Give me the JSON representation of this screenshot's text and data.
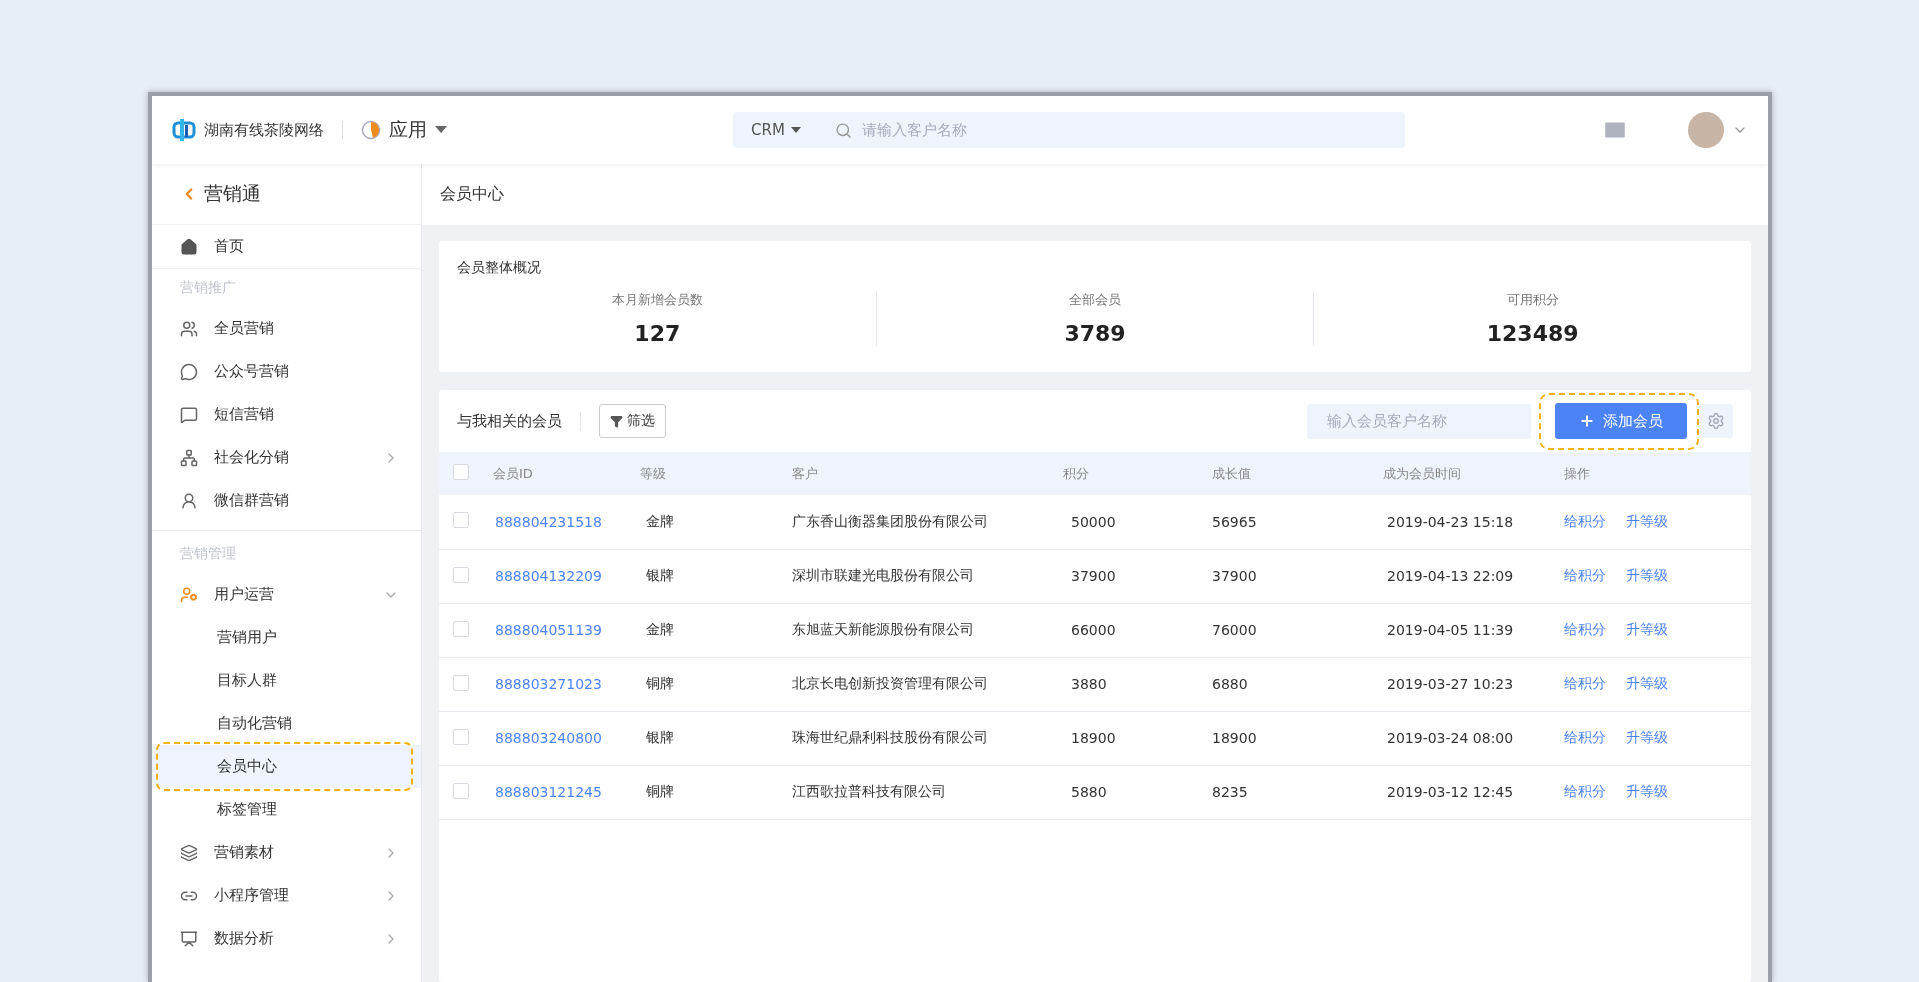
{
  "header": {
    "org_name": "湖南有线茶陵网络",
    "app_switcher": "应用",
    "scope": "CRM",
    "search": {
      "placeholder": "请输入客户名称"
    }
  },
  "sidebar": {
    "title": "营销通",
    "home": {
      "label": "首页",
      "selected": false
    },
    "groups": [
      {
        "title": "营销推广",
        "items": [
          {
            "label": "全员营销",
            "has_arrow": false,
            "expanded": false
          },
          {
            "label": "公众号营销",
            "has_arrow": false,
            "expanded": false
          },
          {
            "label": "短信营销",
            "has_arrow": false,
            "expanded": false
          },
          {
            "label": "社会化分销",
            "has_arrow": true,
            "expanded": false
          },
          {
            "label": "微信群营销",
            "has_arrow": false,
            "expanded": false
          }
        ]
      },
      {
        "title": "营销管理",
        "items": [
          {
            "label": "用户运营",
            "has_arrow": true,
            "expanded": true,
            "children": [
              {
                "label": "营销用户",
                "selected": false
              },
              {
                "label": "目标人群",
                "selected": false
              },
              {
                "label": "自动化营销",
                "selected": false
              },
              {
                "label": "会员中心",
                "selected": true
              },
              {
                "label": "标签管理",
                "selected": false
              }
            ]
          },
          {
            "label": "营销素材",
            "has_arrow": true,
            "expanded": false
          },
          {
            "label": "小程序管理",
            "has_arrow": true,
            "expanded": false
          },
          {
            "label": "数据分析",
            "has_arrow": true,
            "expanded": false
          }
        ]
      }
    ]
  },
  "page_title": "会员中心",
  "overview": {
    "title": "会员整体概况",
    "stats": [
      {
        "label": "本月新增会员数",
        "value": "127"
      },
      {
        "label": "全部会员",
        "value": "3789"
      },
      {
        "label": "可用积分",
        "value": "123489"
      }
    ]
  },
  "members": {
    "title": "与我相关的会员",
    "filter_button": "筛选",
    "search": {
      "placeholder": "输入会员客户名称"
    },
    "add_button": {
      "label": "添加会员",
      "highlighted": true
    },
    "select_all_checked": false,
    "columns": [
      "会员ID",
      "等级",
      "客户",
      "积分",
      "成长值",
      "成为会员时间",
      "操作"
    ],
    "rows": [
      {
        "id": "888804231518",
        "level": "金牌",
        "customer": "广东香山衡器集团股份有限公司",
        "points": "50000",
        "growth": "56965",
        "joined": "2019-04-23 15:18",
        "actions": [
          "给积分",
          "升等级"
        ],
        "checked": false
      },
      {
        "id": "888804132209",
        "level": "银牌",
        "customer": "深圳市联建光电股份有限公司",
        "points": "37900",
        "growth": "37900",
        "joined": "2019-04-13 22:09",
        "actions": [
          "给积分",
          "升等级"
        ],
        "checked": false
      },
      {
        "id": "888804051139",
        "level": "金牌",
        "customer": "东旭蓝天新能源股份有限公司",
        "points": "66000",
        "growth": "76000",
        "joined": "2019-04-05 11:39",
        "actions": [
          "给积分",
          "升等级"
        ],
        "checked": false
      },
      {
        "id": "888803271023",
        "level": "铜牌",
        "customer": "北京长电创新投资管理有限公司",
        "points": "3880",
        "growth": "6880",
        "joined": "2019-03-27 10:23",
        "actions": [
          "给积分",
          "升等级"
        ],
        "checked": false
      },
      {
        "id": "888803240800",
        "level": "银牌",
        "customer": "珠海世纪鼎利科技股份有限公司",
        "points": "18900",
        "growth": "18900",
        "joined": "2019-03-24 08:00",
        "actions": [
          "给积分",
          "升等级"
        ],
        "checked": false
      },
      {
        "id": "888803121245",
        "level": "铜牌",
        "customer": "江西歌拉普科技有限公司",
        "points": "5880",
        "growth": "8235",
        "joined": "2019-03-12 12:45",
        "actions": [
          "给积分",
          "升等级"
        ],
        "checked": false
      }
    ]
  }
}
